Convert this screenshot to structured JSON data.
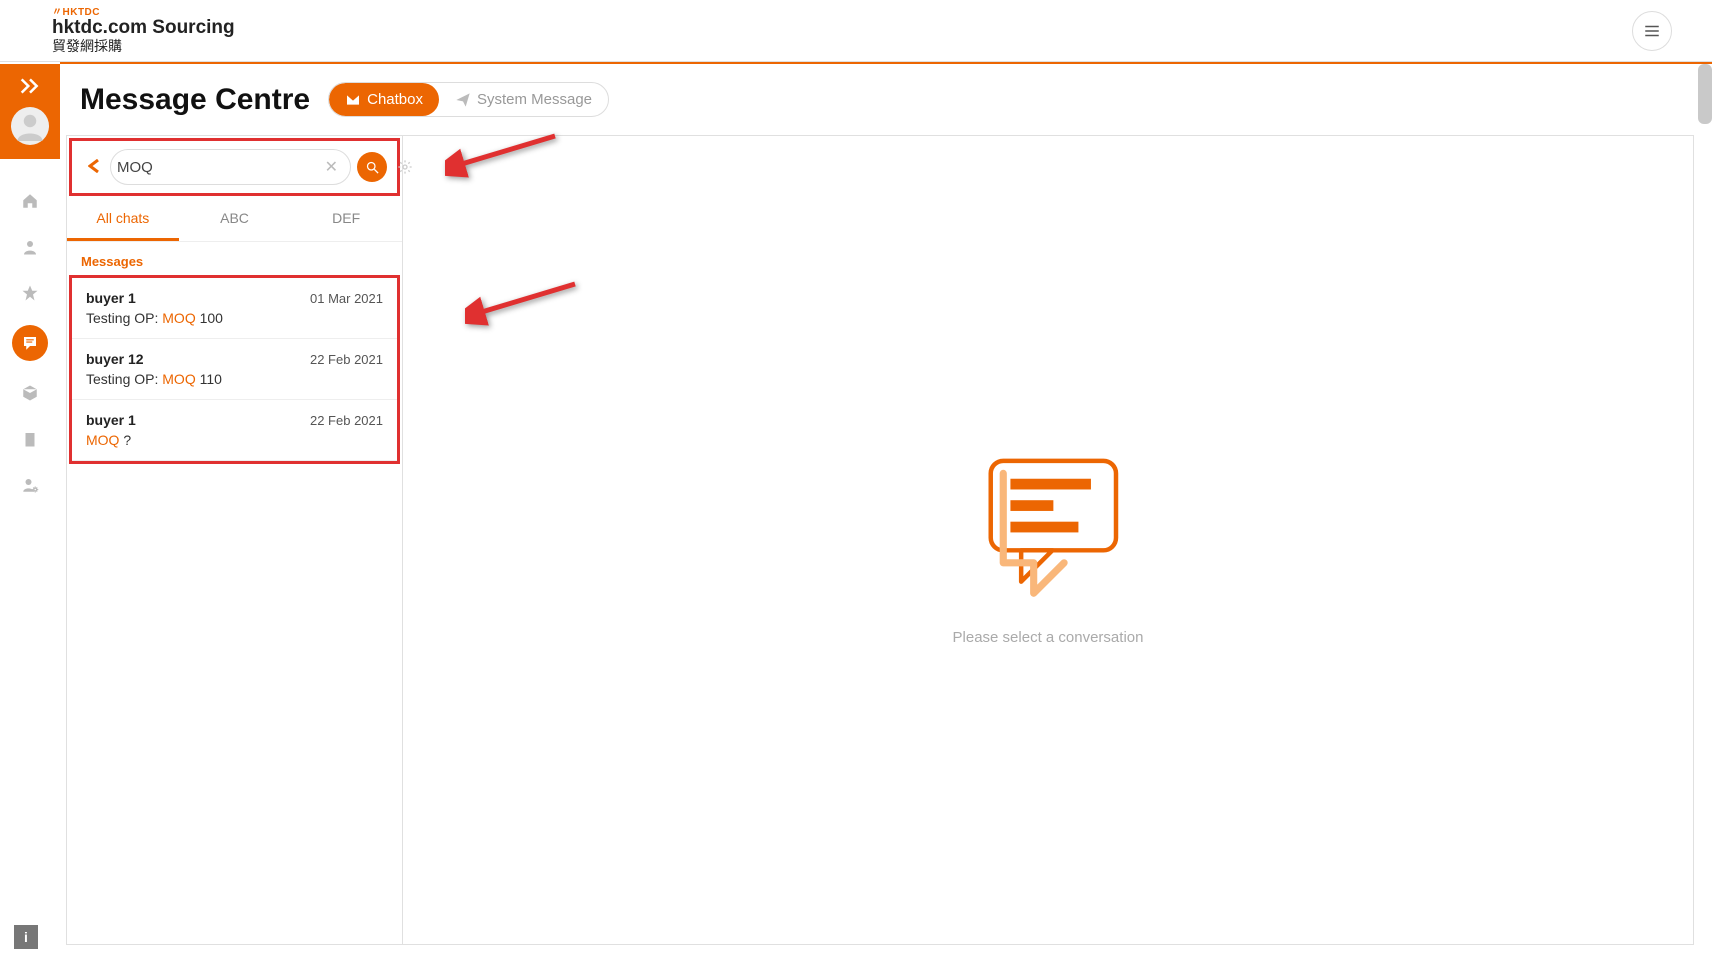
{
  "brand": {
    "logo_prefix": "〃",
    "logo_text": "HKTDC",
    "title": "hktdc.com Sourcing",
    "subtitle": "貿發網採購"
  },
  "page": {
    "title": "Message Centre",
    "tabs": {
      "chatbox": "Chatbox",
      "system": "System Message"
    }
  },
  "search": {
    "value": "MOQ"
  },
  "mini_tabs": {
    "all": "All chats",
    "abc": "ABC",
    "def": "DEF"
  },
  "section_label": "Messages",
  "messages": [
    {
      "name": "buyer 1",
      "date": "01 Mar 2021",
      "pre": "Testing OP: ",
      "hl": "MOQ",
      "post": " 100"
    },
    {
      "name": "buyer 12",
      "date": "22 Feb 2021",
      "pre": "Testing OP: ",
      "hl": "MOQ",
      "post": " 110"
    },
    {
      "name": "buyer 1",
      "date": "22 Feb 2021",
      "pre": "",
      "hl": "MOQ",
      "post": " ?"
    }
  ],
  "empty": {
    "text": "Please select a conversation"
  },
  "info": {
    "label": "i"
  }
}
